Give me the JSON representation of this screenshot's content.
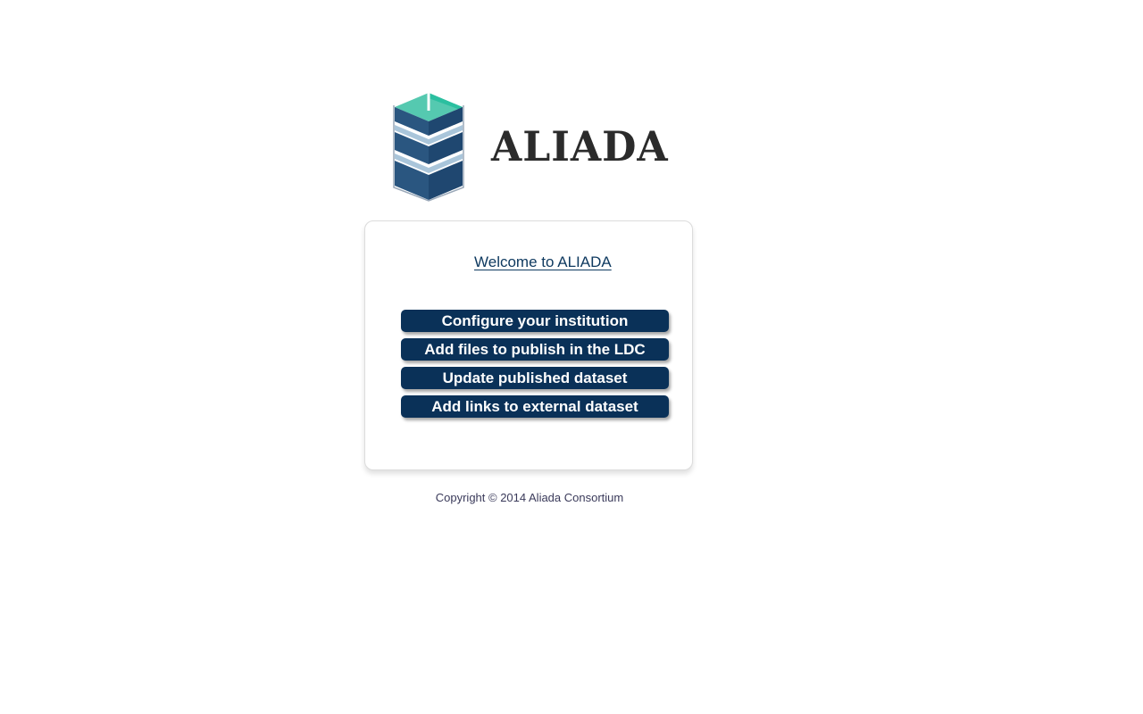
{
  "logo": {
    "text": "ALIADA",
    "icon": "stacked-layers-logo-icon",
    "colors": {
      "teal": "#2bbfa0",
      "navy": "#1f4770",
      "light_blue": "#8fb3cf",
      "text": "#2b2b2b"
    }
  },
  "panel": {
    "title": "Welcome to ALIADA",
    "buttons": [
      {
        "label": "Configure your institution"
      },
      {
        "label": "Add files to publish in the LDC"
      },
      {
        "label": "Update published dataset"
      },
      {
        "label": "Add links to external dataset"
      }
    ]
  },
  "footer": {
    "copyright": "Copyright © 2014 Aliada Consortium"
  },
  "colors": {
    "button_bg": "#0a3158",
    "button_text": "#ffffff",
    "title_link": "#0f3a60",
    "panel_border": "#dcdcdc"
  }
}
